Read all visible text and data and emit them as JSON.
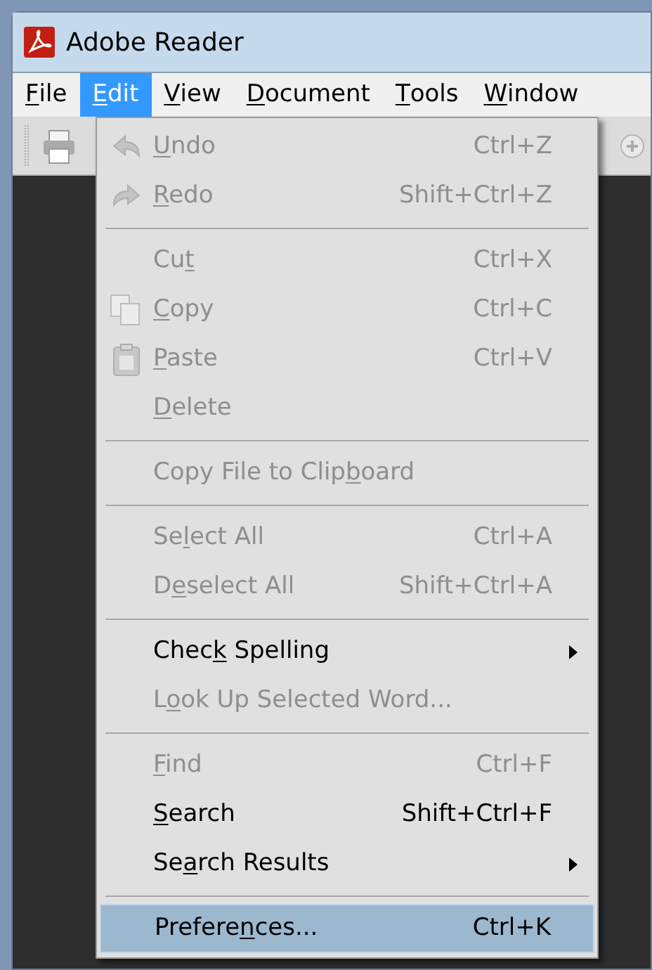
{
  "window": {
    "title": "Adobe Reader"
  },
  "menubar": [
    {
      "label": {
        "key": "F",
        "post": "ile"
      },
      "selected": false
    },
    {
      "label": {
        "key": "E",
        "post": "dit"
      },
      "selected": true
    },
    {
      "label": {
        "key": "V",
        "post": "iew"
      },
      "selected": false
    },
    {
      "label": {
        "key": "D",
        "post": "ocument"
      },
      "selected": false
    },
    {
      "label": {
        "key": "T",
        "post": "ools"
      },
      "selected": false
    },
    {
      "label": {
        "key": "W",
        "post": "indow"
      },
      "selected": false
    }
  ],
  "menu": [
    {
      "kind": "item",
      "label": {
        "key": "U",
        "post": "ndo"
      },
      "shortcut": "Ctrl+Z",
      "disabled": true,
      "submenu": false,
      "selected": false
    },
    {
      "kind": "item",
      "label": {
        "key": "R",
        "post": "edo"
      },
      "shortcut": "Shift+Ctrl+Z",
      "disabled": true,
      "submenu": false,
      "selected": false
    },
    {
      "kind": "separator"
    },
    {
      "kind": "item",
      "label": {
        "pre": "Cu",
        "key": "t"
      },
      "shortcut": "Ctrl+X",
      "disabled": true,
      "submenu": false,
      "selected": false
    },
    {
      "kind": "item",
      "label": {
        "key": "C",
        "post": "opy"
      },
      "shortcut": "Ctrl+C",
      "disabled": true,
      "submenu": false,
      "selected": false
    },
    {
      "kind": "item",
      "label": {
        "key": "P",
        "post": "aste"
      },
      "shortcut": "Ctrl+V",
      "disabled": true,
      "submenu": false,
      "selected": false
    },
    {
      "kind": "item",
      "label": {
        "key": "D",
        "post": "elete"
      },
      "disabled": true,
      "submenu": false,
      "selected": false
    },
    {
      "kind": "separator"
    },
    {
      "kind": "item",
      "label": {
        "pre": "Copy File to Clip",
        "key": "b",
        "post": "oard"
      },
      "disabled": true,
      "submenu": false,
      "selected": false
    },
    {
      "kind": "separator"
    },
    {
      "kind": "item",
      "label": {
        "pre": "Se",
        "key": "l",
        "post": "ect All"
      },
      "shortcut": "Ctrl+A",
      "disabled": true,
      "submenu": false,
      "selected": false
    },
    {
      "kind": "item",
      "label": {
        "pre": "D",
        "key": "e",
        "post": "select All"
      },
      "shortcut": "Shift+Ctrl+A",
      "disabled": true,
      "submenu": false,
      "selected": false
    },
    {
      "kind": "separator"
    },
    {
      "kind": "item",
      "label": {
        "pre": "Chec",
        "key": "k",
        "post": " Spelling"
      },
      "disabled": false,
      "submenu": true,
      "selected": false
    },
    {
      "kind": "item",
      "label": {
        "pre": "L",
        "key": "o",
        "post": "ok Up Selected Word..."
      },
      "disabled": true,
      "submenu": false,
      "selected": false
    },
    {
      "kind": "separator"
    },
    {
      "kind": "item",
      "label": {
        "key": "F",
        "post": "ind"
      },
      "shortcut": "Ctrl+F",
      "disabled": true,
      "submenu": false,
      "selected": false
    },
    {
      "kind": "item",
      "label": {
        "key": "S",
        "post": "earch"
      },
      "shortcut": "Shift+Ctrl+F",
      "disabled": false,
      "submenu": false,
      "selected": false
    },
    {
      "kind": "item",
      "label": {
        "pre": "Se",
        "key": "a",
        "post": "rch Results"
      },
      "disabled": false,
      "submenu": true,
      "selected": false
    },
    {
      "kind": "separator"
    },
    {
      "kind": "item",
      "label": {
        "pre": "Prefere",
        "key": "n",
        "post": "ces..."
      },
      "shortcut": "Ctrl+K",
      "disabled": false,
      "submenu": false,
      "selected": true
    }
  ]
}
